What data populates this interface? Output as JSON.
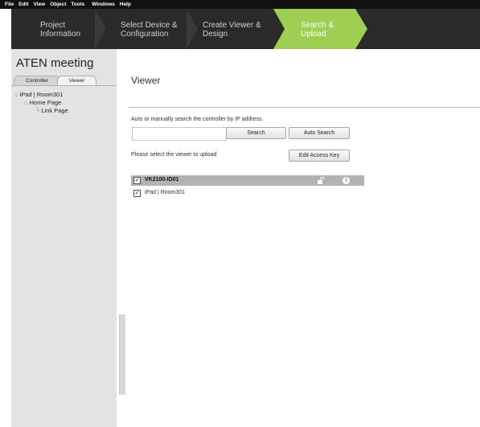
{
  "menu": [
    "File",
    "Edit",
    "View",
    "Object",
    "Tools",
    "Windows",
    "Help"
  ],
  "wizard": {
    "steps": [
      {
        "line1": "Project",
        "line2": "Information"
      },
      {
        "line1": "Select Device &",
        "line2": "Configuration"
      },
      {
        "line1": "Create Viewer &",
        "line2": "Design"
      },
      {
        "line1": "Search &",
        "line2": "Upload"
      }
    ]
  },
  "sidebar": {
    "title": "ATEN meeting",
    "tabs": [
      "Controller",
      "Viewer"
    ],
    "tree": {
      "root": "iPad | Room301",
      "child": "Home Page",
      "grandchild": "Link Page"
    }
  },
  "main": {
    "title": "Viewer",
    "search_hint": "Auto or manually search the controller by IP address.",
    "ip_value": "",
    "search_button": "Search",
    "auto_search_button": "Auto Search",
    "select_hint": "Please select the viewer to upload",
    "edit_key_button": "Edit Access Key",
    "device": {
      "name": "VK2100-ID01",
      "checked": true,
      "viewers": [
        {
          "label": "iPad | Room301",
          "checked": true
        }
      ]
    }
  },
  "colors": {
    "menubar": "#111111",
    "wizard_bg": "#2a2a2a",
    "active_step": "#9ecf52",
    "sidebar_bg": "#e3e3e3",
    "device_row": "#b3b3b3"
  }
}
